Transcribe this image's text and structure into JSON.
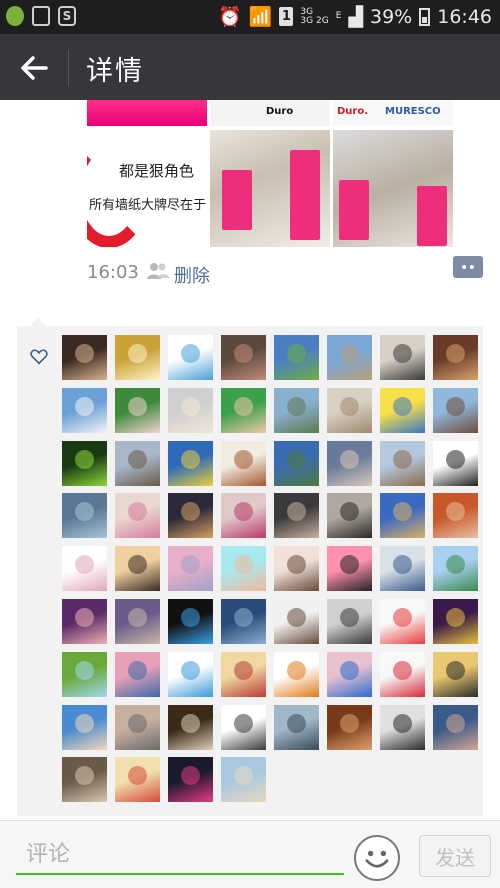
{
  "status_bar": {
    "signal_label": "3G",
    "net_label_top": "3G",
    "net_label_bottom": "2G",
    "edge_label": "E",
    "sim_label": "1",
    "battery": "39%",
    "time": "16:46"
  },
  "header": {
    "title": "详情",
    "back_icon": "back-arrow-icon"
  },
  "post": {
    "image_texts": {
      "caption_line1": "都是狠角色",
      "caption_line2": "所有墙纸大牌尽在于",
      "brand_duro_left": "Duro",
      "brand_duro_right": "Duro.",
      "brand_muresco": "MURESCO"
    },
    "time": "16:03",
    "delete_label": "删除"
  },
  "likes": {
    "icon": "heart-outline-icon",
    "avatars": [
      {
        "c1": "#3a2a22",
        "c2": "#d9b48f"
      },
      {
        "c1": "#caa23a",
        "c2": "#fff3c4"
      },
      {
        "c1": "#ffffff",
        "c2": "#46a0d8"
      },
      {
        "c1": "#5a4a3e",
        "c2": "#c48a7a"
      },
      {
        "c1": "#4b7fc3",
        "c2": "#6fae3d"
      },
      {
        "c1": "#7ba7d8",
        "c2": "#b6a07a"
      },
      {
        "c1": "#d7d0c6",
        "c2": "#3a3a3a"
      },
      {
        "c1": "#6b3b2a",
        "c2": "#d8a26a"
      },
      {
        "c1": "#6aa0d8",
        "c2": "#f4f4f4"
      },
      {
        "c1": "#3d8a3a",
        "c2": "#f2d2d2"
      },
      {
        "c1": "#cfcfcf",
        "c2": "#f1e6d6"
      },
      {
        "c1": "#3aa04a",
        "c2": "#f0c8a8"
      },
      {
        "c1": "#8ab0d0",
        "c2": "#5e7a4e"
      },
      {
        "c1": "#d8d0c2",
        "c2": "#a08870"
      },
      {
        "c1": "#f7e04a",
        "c2": "#3a76c6"
      },
      {
        "c1": "#90b8da",
        "c2": "#704a3a"
      },
      {
        "c1": "#1a3a12",
        "c2": "#8ad83a"
      },
      {
        "c1": "#a8b8c8",
        "c2": "#6a5a4a"
      },
      {
        "c1": "#2f6ab8",
        "c2": "#ead03a"
      },
      {
        "c1": "#f1ebe0",
        "c2": "#a4572e"
      },
      {
        "c1": "#3a6cb4",
        "c2": "#4e7a3a"
      },
      {
        "c1": "#6a7a9a",
        "c2": "#d8c8b8"
      },
      {
        "c1": "#b4c8e0",
        "c2": "#8a6a4a"
      },
      {
        "c1": "#ffffff",
        "c2": "#202020"
      },
      {
        "c1": "#5a7896",
        "c2": "#a8c4d8"
      },
      {
        "c1": "#e8d8d0",
        "c2": "#d87aa0"
      },
      {
        "c1": "#2a2a3a",
        "c2": "#d8a060"
      },
      {
        "c1": "#e0c8c8",
        "c2": "#b83a6a"
      },
      {
        "c1": "#3a3a3a",
        "c2": "#c8b0a0"
      },
      {
        "c1": "#b0a8a0",
        "c2": "#2a2a2a"
      },
      {
        "c1": "#3a6ac0",
        "c2": "#d8b068"
      },
      {
        "c1": "#c8582a",
        "c2": "#e8c0a0"
      },
      {
        "c1": "#ffffff",
        "c2": "#e0a8b8"
      },
      {
        "c1": "#f0d0a0",
        "c2": "#3a2a22"
      },
      {
        "c1": "#e8b0c8",
        "c2": "#a0a0c8"
      },
      {
        "c1": "#a8e8f0",
        "c2": "#f0b89a"
      },
      {
        "c1": "#f0e0d8",
        "c2": "#6a4a3a"
      },
      {
        "c1": "#ff90b0",
        "c2": "#222222"
      },
      {
        "c1": "#d8e0e8",
        "c2": "#3a5a8a"
      },
      {
        "c1": "#a8d0f0",
        "c2": "#3a8a4a"
      },
      {
        "c1": "#5a2a6a",
        "c2": "#f0b0b0"
      },
      {
        "c1": "#6a5a8a",
        "c2": "#c8b8a8"
      },
      {
        "c1": "#111111",
        "c2": "#3aa0e8"
      },
      {
        "c1": "#2a4a7a",
        "c2": "#8ab0d0"
      },
      {
        "c1": "#f0f0f0",
        "c2": "#6a4a3a"
      },
      {
        "c1": "#d0d0d0",
        "c2": "#3a3a3a"
      },
      {
        "c1": "#f8f8f8",
        "c2": "#e83a3a"
      },
      {
        "c1": "#3a1a4a",
        "c2": "#e8c03a"
      },
      {
        "c1": "#6aa83a",
        "c2": "#a0d8f0"
      },
      {
        "c1": "#e8a0b8",
        "c2": "#3a6aa8"
      },
      {
        "c1": "#ffffff",
        "c2": "#3a9ad8"
      },
      {
        "c1": "#f0d8a0",
        "c2": "#b83a3a"
      },
      {
        "c1": "#ffffff",
        "c2": "#e07a1a"
      },
      {
        "c1": "#e8c0d0",
        "c2": "#2a6ad0"
      },
      {
        "c1": "#f8f8f8",
        "c2": "#d82a3a"
      },
      {
        "c1": "#e8c870",
        "c2": "#2a2a2a"
      },
      {
        "c1": "#4a8ad0",
        "c2": "#f0d8b8"
      },
      {
        "c1": "#c8b0a0",
        "c2": "#6a6a6a"
      },
      {
        "c1": "#3a2a1a",
        "c2": "#e0d0b8"
      },
      {
        "c1": "#ffffff",
        "c2": "#3a3a3a"
      },
      {
        "c1": "#a0b8c8",
        "c2": "#3a4a5a"
      },
      {
        "c1": "#7a3a1a",
        "c2": "#e0a070"
      },
      {
        "c1": "#e0e0e0",
        "c2": "#2a2a2a"
      },
      {
        "c1": "#3a5a8a",
        "c2": "#d0a890"
      },
      {
        "c1": "#6a5a4a",
        "c2": "#d8c8b0"
      },
      {
        "c1": "#f0e0b0",
        "c2": "#d84a3a"
      },
      {
        "c1": "#1a1a2a",
        "c2": "#e83a8a"
      },
      {
        "c1": "#a8c8e0",
        "c2": "#e8d8c0"
      }
    ]
  },
  "comment_bar": {
    "placeholder": "评论",
    "emoji_icon": "smiley-icon",
    "send_label": "发送"
  }
}
